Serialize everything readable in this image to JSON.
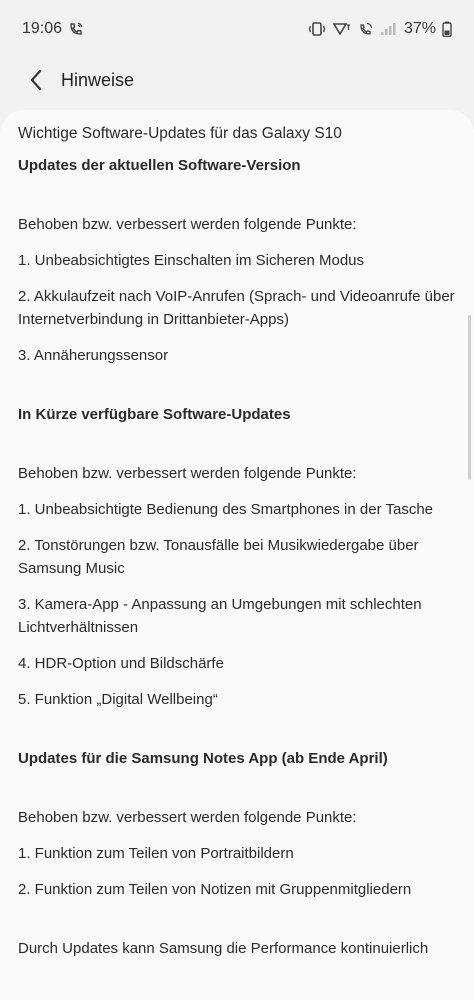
{
  "status_bar": {
    "time": "19:06",
    "battery_percent": "37%"
  },
  "header": {
    "title": "Hinweise"
  },
  "article": {
    "intro": "Wichtige Software-Updates für das Galaxy S10",
    "sections": [
      {
        "heading": "Updates der aktuellen Software-Version",
        "lead": "Behoben bzw. verbessert werden folgende Punkte:",
        "items": [
          "1. Unbeabsichtigtes Einschalten im Sicheren Modus",
          "2. Akkulaufzeit nach VoIP-Anrufen (Sprach- und Videoanrufe über Internetverbindung in Drittanbieter-Apps)",
          "3. Annäherungssensor"
        ]
      },
      {
        "heading": "In Kürze verfügbare Software-Updates",
        "lead": "Behoben bzw. verbessert werden folgende Punkte:",
        "items": [
          "1. Unbeabsichtigte Bedienung des Smartphones in der Tasche",
          "2. Tonstörungen bzw. Tonausfälle bei Musikwiedergabe über Samsung Music",
          "3. Kamera-App - Anpassung an Umgebungen mit schlechten Lichtverhältnissen",
          "4. HDR-Option und Bildschärfe",
          "5. Funktion „Digital Wellbeing“"
        ]
      },
      {
        "heading": "Updates für die Samsung Notes App (ab Ende April)",
        "lead": "Behoben bzw. verbessert werden folgende Punkte:",
        "items": [
          "1. Funktion zum Teilen von Portraitbildern",
          "2. Funktion zum Teilen von Notizen mit Gruppenmitgliedern"
        ]
      }
    ],
    "footer": "Durch Updates kann Samsung die Performance kontinuierlich"
  }
}
